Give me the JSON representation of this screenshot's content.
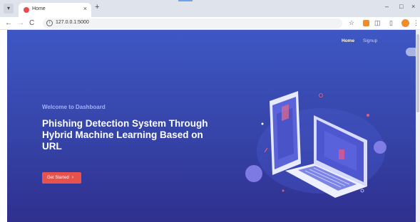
{
  "browser": {
    "tab_title": "Home",
    "tab_close": "×",
    "new_tab": "+",
    "url": "127.0.0.1:5000",
    "controls": {
      "minimize": "–",
      "maximize": "□",
      "close": "×"
    },
    "nav": {
      "back": "←",
      "forward": "→",
      "reload": "C"
    }
  },
  "nav": {
    "home": "Home",
    "signup": "Signup"
  },
  "hero": {
    "welcome": "Welcome to Dashboard",
    "headline": "Phishing Detection System Through Hybrid Machine Learning Based on URL",
    "cta": "Get Started",
    "cta_arrow": "›"
  },
  "colors": {
    "accent": "#e8524d",
    "bg_top": "#3e57c3",
    "bg_bottom": "#2f2f8e"
  },
  "icons": [
    "tab-menu-icon",
    "favicon-icon",
    "close-icon",
    "plus-icon",
    "back-icon",
    "forward-icon",
    "reload-icon",
    "info-icon",
    "star-icon",
    "extension-icon",
    "puzzle-icon",
    "sidepanel-icon",
    "profile-icon",
    "menu-icon"
  ]
}
